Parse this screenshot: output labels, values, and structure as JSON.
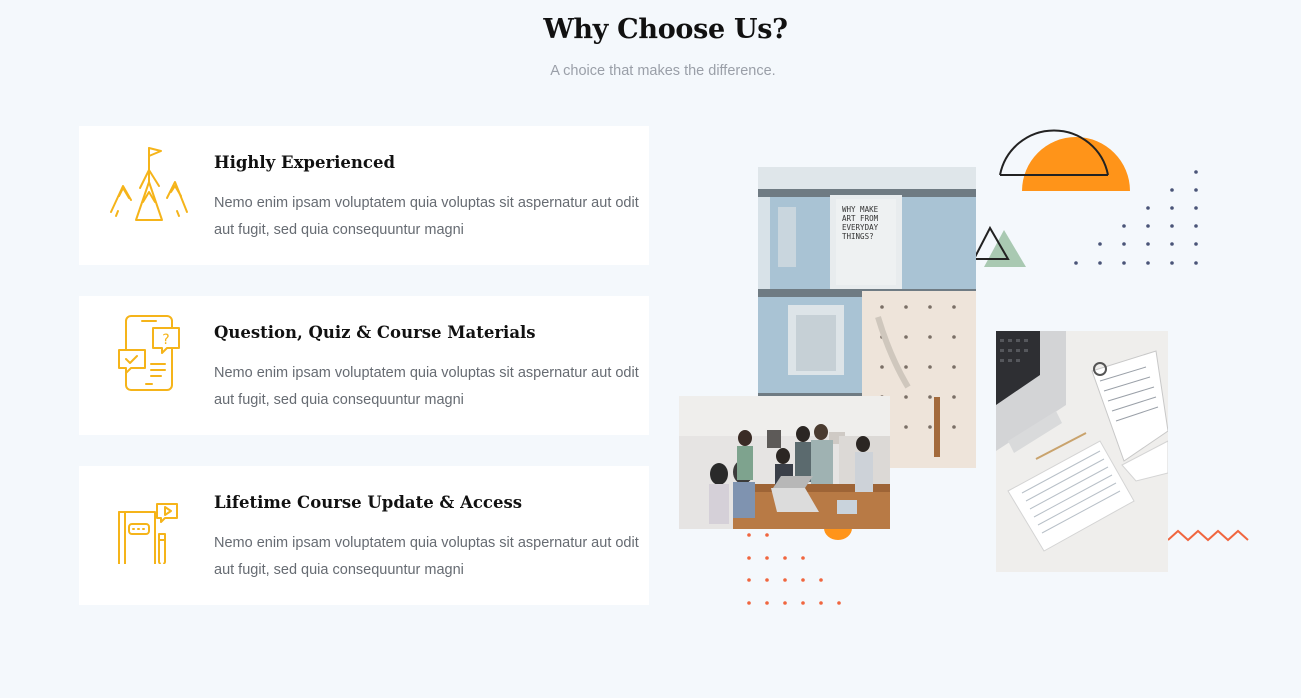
{
  "section": {
    "title": "Why Choose Us?",
    "subtitle": "A choice that makes the difference."
  },
  "features": [
    {
      "icon": "mountain-flag-icon",
      "title": "Highly Experienced",
      "description": "Nemo enim ipsam voluptatem quia voluptas sit aspernatur aut odit aut fugit, sed quia consequuntur magni"
    },
    {
      "icon": "mobile-quiz-icon",
      "title": "Question, Quiz & Course Materials",
      "description": "Nemo enim ipsam voluptatem quia voluptas sit aspernatur aut odit aut fugit, sed quia consequuntur magni"
    },
    {
      "icon": "notebook-video-icon",
      "title": "Lifetime Course Update & Access",
      "description": "Nemo enim ipsam voluptatem quia voluptas sit aspernatur aut odit aut fugit, sed quia consequuntur magni"
    }
  ],
  "poster_text": [
    "WHY MAKE",
    "ART FROM",
    "EVERYDAY",
    "THINGS?"
  ],
  "colors": {
    "background": "#f4f8fc",
    "icon": "#f5b41a",
    "accent_orange": "#ff9419",
    "dots_navy": "#4a5578",
    "dots_orange": "#f0663f",
    "triangle_green": "#a9c9b2"
  }
}
